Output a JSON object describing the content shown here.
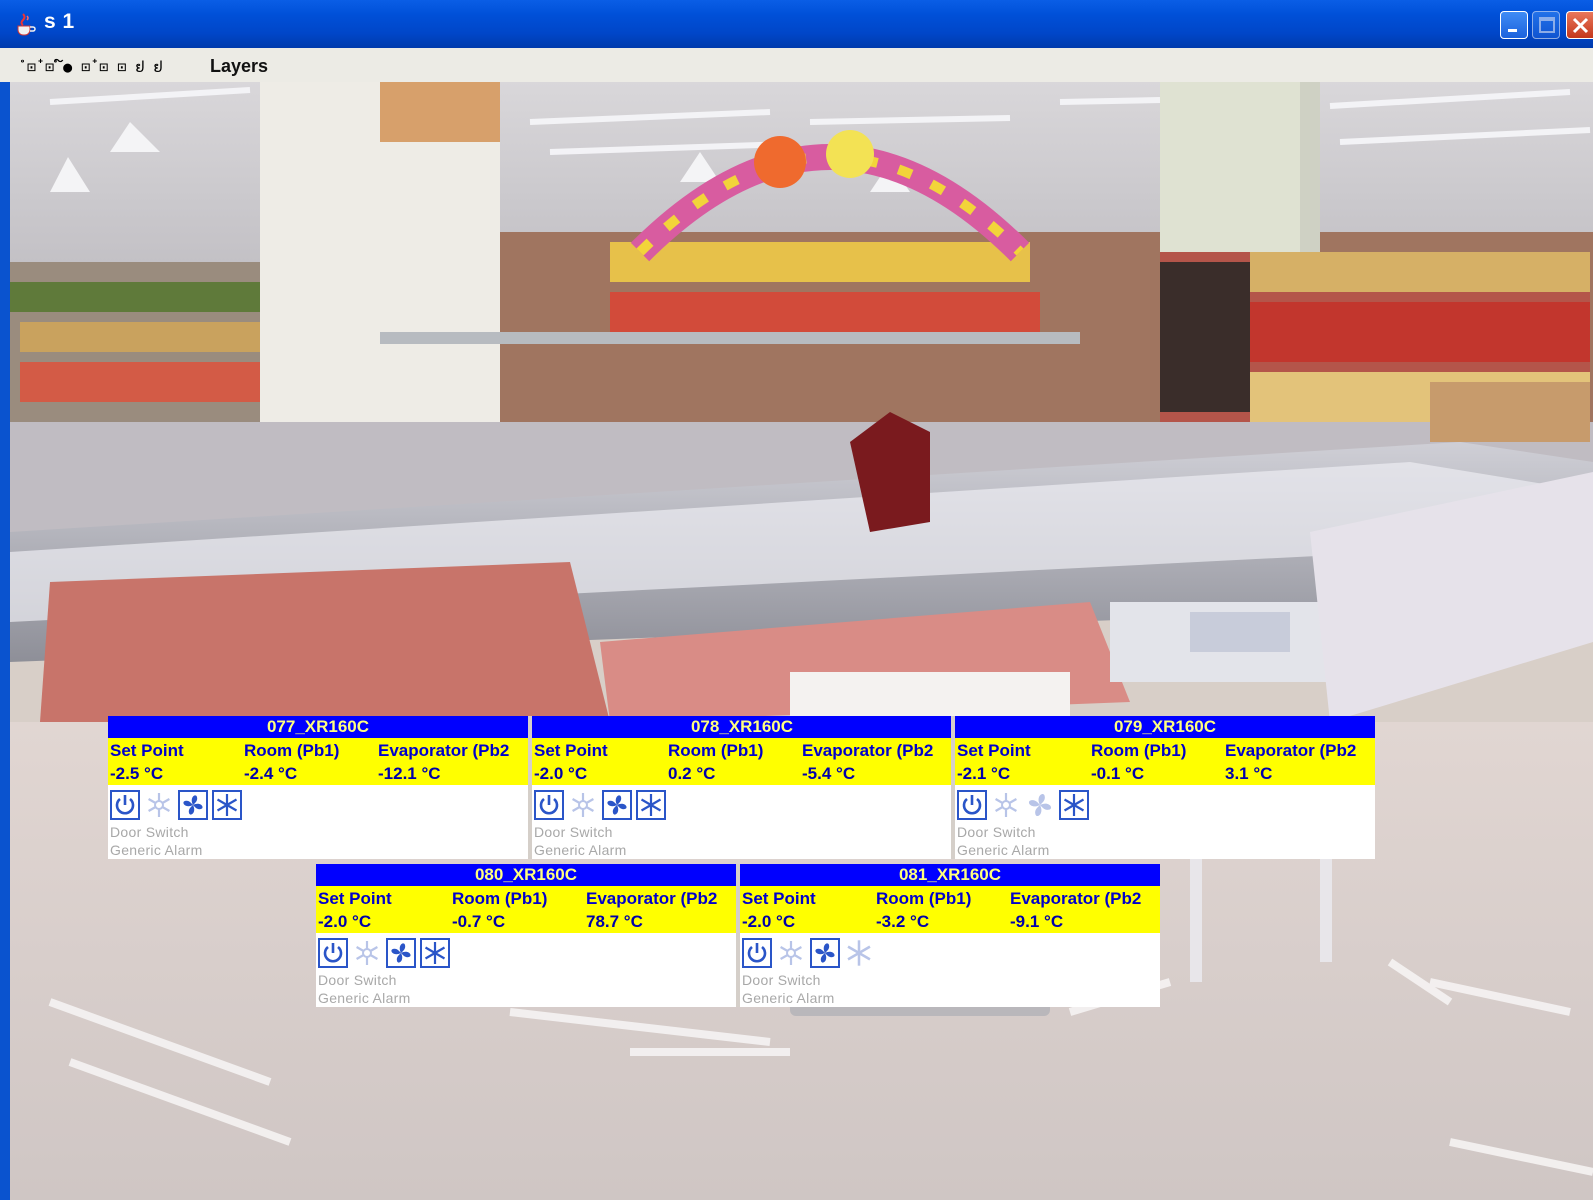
{
  "window": {
    "title": "s 1"
  },
  "menu": {
    "items": [
      {
        "label": "ໍ ⊡໋ ⊡໌ ● ⊡໋ ⊡ ⊡ ຢ ຢ"
      },
      {
        "label": "Layers"
      }
    ]
  },
  "panel_headers": {
    "setpoint": "Set Point",
    "room": "Room (Pb1)",
    "evaporator": "Evaporator (Pb2"
  },
  "panels": [
    {
      "name": "077_XR160C",
      "setpoint": "-2.5 °C",
      "room": "-2.4 °C",
      "evaporator": "-12.1 °C",
      "door": "Door Switch",
      "alarm": "Generic Alarm",
      "icons": {
        "power": true,
        "defrost": false,
        "fan": true,
        "compressor": true
      }
    },
    {
      "name": "078_XR160C",
      "setpoint": "-2.0 °C",
      "room": "0.2 °C",
      "evaporator": "-5.4 °C",
      "door": "Door Switch",
      "alarm": "Generic Alarm",
      "icons": {
        "power": true,
        "defrost": false,
        "fan": true,
        "compressor": true
      }
    },
    {
      "name": "079_XR160C",
      "setpoint": "-2.1 °C",
      "room": "-0.1 °C",
      "evaporator": "3.1 °C",
      "door": "Door Switch",
      "alarm": "Generic Alarm",
      "icons": {
        "power": true,
        "defrost": false,
        "fan": false,
        "compressor": true
      }
    },
    {
      "name": "080_XR160C",
      "setpoint": "-2.0 °C",
      "room": "-0.7 °C",
      "evaporator": "78.7 °C",
      "door": "Door Switch",
      "alarm": "Generic Alarm",
      "icons": {
        "power": true,
        "defrost": false,
        "fan": true,
        "compressor": true
      }
    },
    {
      "name": "081_XR160C",
      "setpoint": "-2.0 °C",
      "room": "-3.2 °C",
      "evaporator": "-9.1 °C",
      "door": "Door Switch",
      "alarm": "Generic Alarm",
      "icons": {
        "power": true,
        "defrost": false,
        "fan": true,
        "compressor": false
      }
    }
  ],
  "colors": {
    "panel_title_bg": "#0000ff",
    "panel_title_text": "#ffff7f",
    "panel_values_bg": "#ffff00",
    "panel_text": "#0000cc",
    "inactive_text": "#a8a8a8",
    "icon_active": "#2a55c8",
    "icon_inactive": "#b8c4e8"
  }
}
